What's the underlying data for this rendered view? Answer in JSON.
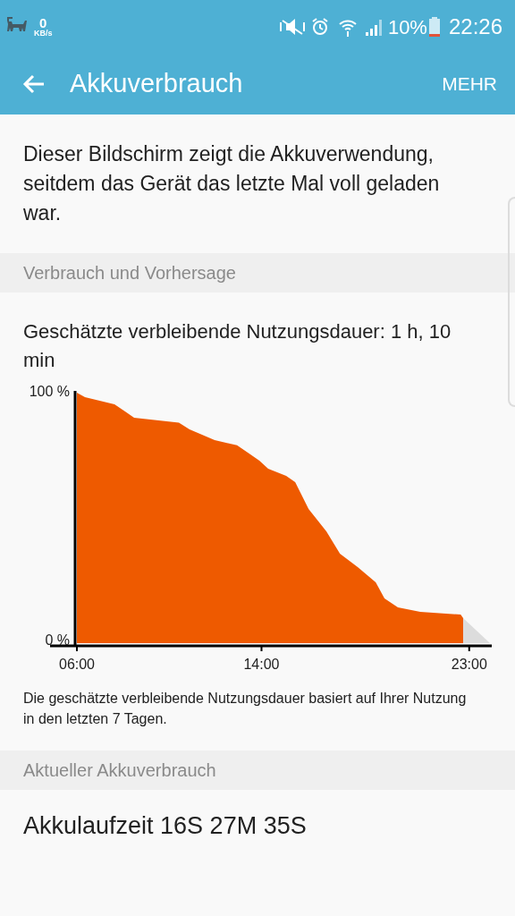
{
  "status_bar": {
    "speed_value": "0",
    "speed_unit": "KB/s",
    "battery_text": "10%",
    "time": "22:26"
  },
  "app_bar": {
    "title": "Akkuverbrauch",
    "action": "MEHR"
  },
  "intro": "Dieser Bildschirm zeigt die Akkuverwendung, seitdem das Gerät das letzte Mal voll geladen war.",
  "section_1": {
    "header": "Verbrauch und Vorhersage",
    "estimate": "Geschätzte verbleibende Nutzungsdauer: 1 h, 10 min",
    "chart_data": {
      "type": "area",
      "x": [
        6.0,
        6.35,
        7.63,
        8.09,
        8.48,
        10.42,
        10.88,
        11.97,
        12.94,
        13.91,
        14.29,
        15.07,
        15.46,
        16.04,
        16.81,
        17.4,
        18.17,
        18.95,
        19.33,
        19.91,
        20.88,
        22.63,
        22.74,
        23.9
      ],
      "series": [
        {
          "color": "#ee5a00",
          "values": [
            100,
            98.2,
            95.4,
            92.5,
            90,
            88,
            85.4,
            81.1,
            79,
            72.9,
            69.6,
            66.8,
            64.3,
            53.6,
            44.6,
            35.7,
            30.4,
            24.3,
            17.9,
            14.3,
            12.5,
            11.4,
            10,
            null
          ]
        },
        {
          "color": "#dcdcdc",
          "values": [
            null,
            null,
            null,
            null,
            null,
            null,
            null,
            null,
            null,
            null,
            null,
            null,
            null,
            null,
            null,
            null,
            null,
            null,
            null,
            null,
            null,
            null,
            10,
            0
          ]
        }
      ],
      "ylim": [
        0,
        100
      ],
      "xlim": [
        6,
        23.9
      ],
      "yticks": [
        {
          "value": 0,
          "label": "0 %"
        },
        {
          "value": 100,
          "label": "100 %"
        }
      ],
      "xticks": [
        {
          "value": 6,
          "label": "06:00"
        },
        {
          "value": 14,
          "label": "14:00"
        },
        {
          "value": 23,
          "label": "23:00"
        }
      ]
    },
    "note": "Die geschätzte verbleibende Nutzungsdauer basiert auf Ihrer Nutzung in den letzten 7 Tagen."
  },
  "section_2": {
    "header": "Aktueller Akkuverbrauch",
    "battery_time": "Akkulaufzeit 16S 27M 35S"
  }
}
